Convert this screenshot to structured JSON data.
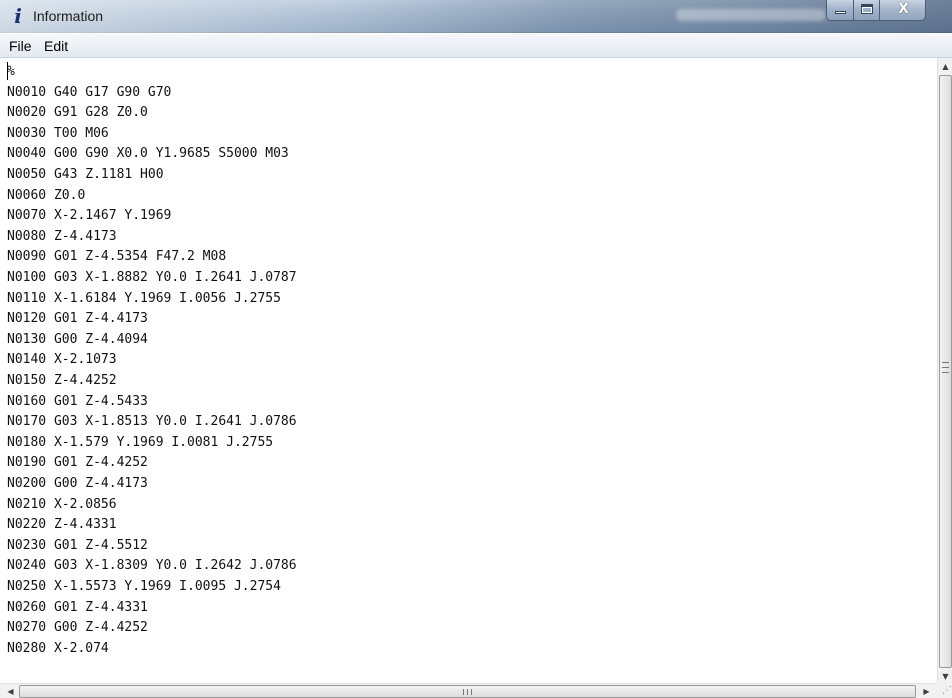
{
  "window": {
    "title": "Information",
    "icon": "info-icon",
    "caption_buttons": {
      "minimize": "minimize-icon",
      "maximize": "maximize-icon",
      "close": "X"
    }
  },
  "menu": {
    "items": [
      {
        "label": "File"
      },
      {
        "label": "Edit"
      }
    ]
  },
  "editor": {
    "lines": [
      "%",
      "N0010 G40 G17 G90 G70",
      "N0020 G91 G28 Z0.0",
      "N0030 T00 M06",
      "N0040 G00 G90 X0.0 Y1.9685 S5000 M03",
      "N0050 G43 Z.1181 H00",
      "N0060 Z0.0",
      "N0070 X-2.1467 Y.1969",
      "N0080 Z-4.4173",
      "N0090 G01 Z-4.5354 F47.2 M08",
      "N0100 G03 X-1.8882 Y0.0 I.2641 J.0787",
      "N0110 X-1.6184 Y.1969 I.0056 J.2755",
      "N0120 G01 Z-4.4173",
      "N0130 G00 Z-4.4094",
      "N0140 X-2.1073",
      "N0150 Z-4.4252",
      "N0160 G01 Z-4.5433",
      "N0170 G03 X-1.8513 Y0.0 I.2641 J.0786",
      "N0180 X-1.579 Y.1969 I.0081 J.2755",
      "N0190 G01 Z-4.4252",
      "N0200 G00 Z-4.4173",
      "N0210 X-2.0856",
      "N0220 Z-4.4331",
      "N0230 G01 Z-4.5512",
      "N0240 G03 X-1.8309 Y0.0 I.2642 J.0786",
      "N0250 X-1.5573 Y.1969 I.0095 J.2754",
      "N0260 G01 Z-4.4331",
      "N0270 G00 Z-4.4252",
      "N0280 X-2.074"
    ]
  },
  "scrollbars": {
    "vertical": {
      "up": "▲",
      "down": "▼"
    },
    "horizontal": {
      "left": "◀",
      "right": "▶"
    }
  },
  "colors": {
    "text": "#111111",
    "background": "#ffffff",
    "titlebar": "#a6b9cf"
  }
}
